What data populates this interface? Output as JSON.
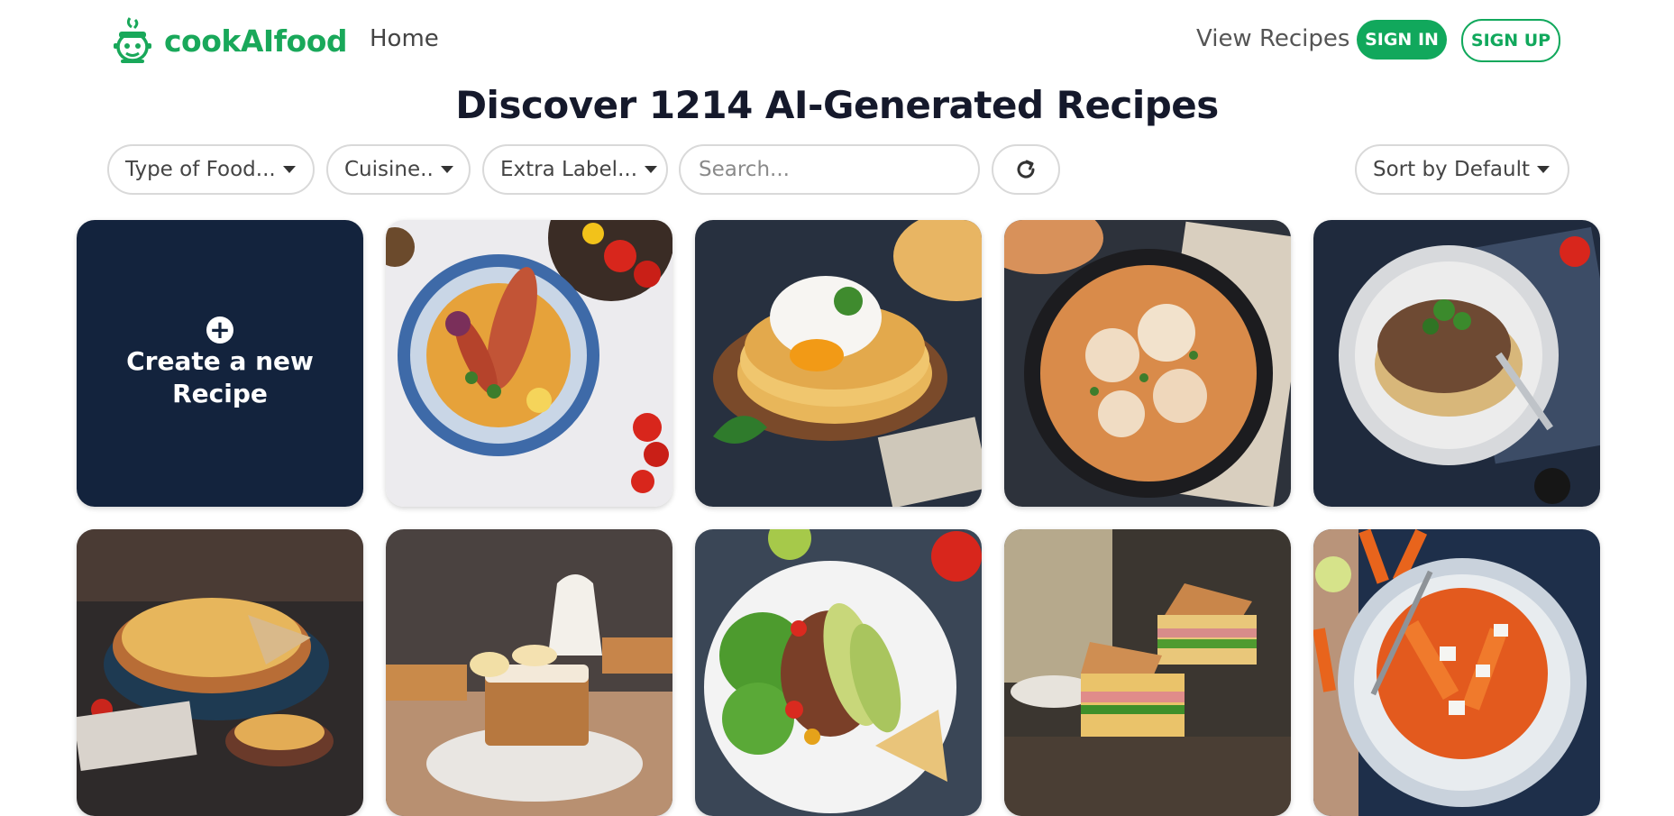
{
  "nav": {
    "brand": "cookAIfood",
    "home": "Home",
    "view_recipes": "View Recipes",
    "sign_in": "SIGN IN",
    "sign_up": "SIGN UP"
  },
  "heading": "Discover 1214 AI-Generated Recipes",
  "filters": {
    "type_of_food": "Type of Food...",
    "cuisine": "Cuisine..",
    "extra_label": "Extra Label...",
    "search_placeholder": "Search...",
    "sort": "Sort by Default"
  },
  "create_card": {
    "label": "Create a new Recipe"
  },
  "recipes": [
    {
      "image": "fish-curry-bowl-photo"
    },
    {
      "image": "flatbread-stack-with-poached-egg-photo"
    },
    {
      "image": "penne-chicken-skillet-photo"
    },
    {
      "image": "meat-sauce-pasta-plate-photo"
    },
    {
      "image": "savory-pie-photo"
    },
    {
      "image": "banana-cake-slice-photo"
    },
    {
      "image": "avocado-bean-salad-photo"
    },
    {
      "image": "ham-sandwiches-photo"
    },
    {
      "image": "carrot-feta-salad-photo"
    }
  ],
  "colors": {
    "brand_green": "#11a85c",
    "heading_navy": "#15192b",
    "create_card_bg": "#13233d"
  }
}
